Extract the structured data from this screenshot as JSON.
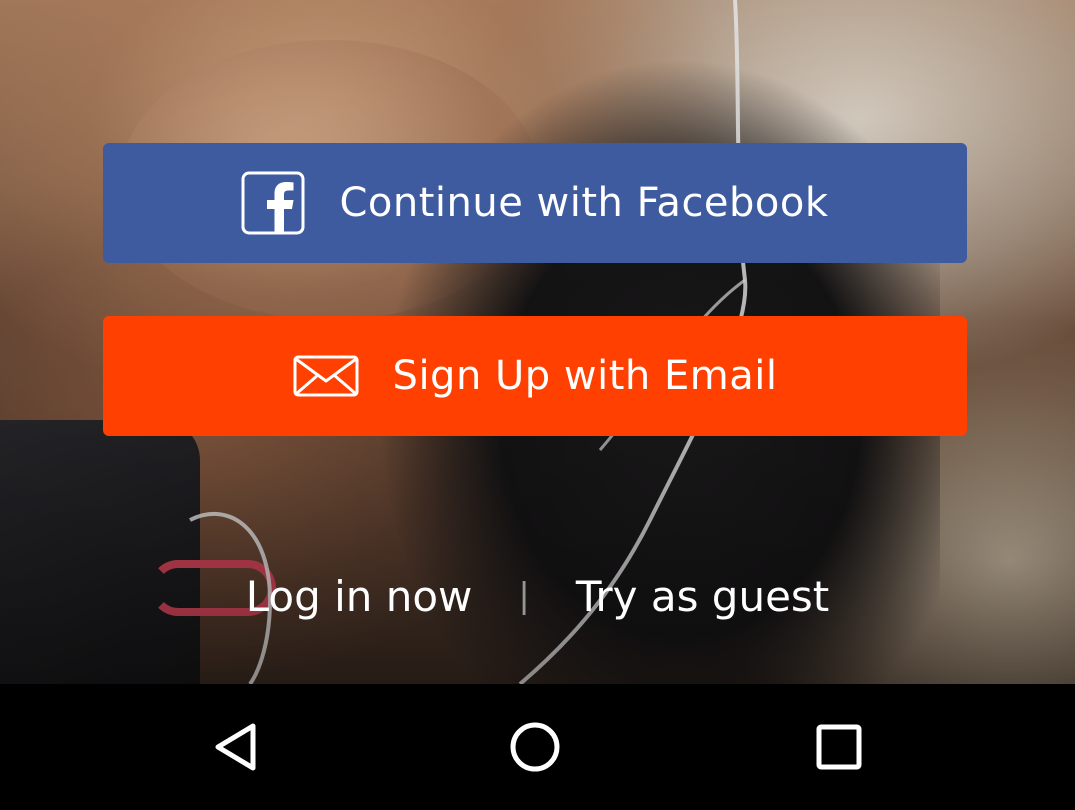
{
  "login": {
    "facebook_label": "Continue with Facebook",
    "email_label": "Sign Up with Email",
    "login_link": "Log in now",
    "separator": "|",
    "guest_link": "Try as guest"
  },
  "icons": {
    "facebook": "facebook-icon",
    "email": "envelope-icon",
    "back": "back-triangle-icon",
    "home": "home-circle-icon",
    "recent": "recent-apps-square-icon"
  },
  "colors": {
    "facebook_button": "#3e5b9f",
    "email_button": "#ff4000",
    "text": "#ffffff",
    "navbar": "#000000"
  }
}
